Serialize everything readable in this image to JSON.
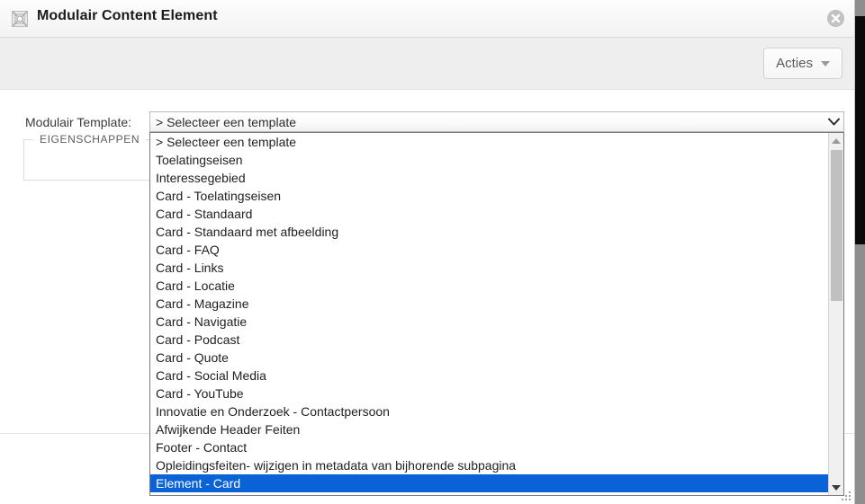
{
  "window": {
    "title": "Modulair Content Element",
    "icon": "content-element-icon",
    "close_icon": "close-circle-icon"
  },
  "toolbar": {
    "actions_label": "Acties",
    "actions_caret_icon": "caret-down-icon"
  },
  "form": {
    "template_label": "Modulair Template:",
    "fieldset_legend": "EIGENSCHAPPEN",
    "select": {
      "value": "> Selecteer een template",
      "arrow_icon": "chevron-down-icon",
      "expanded": true,
      "selected_option": "Element - Card",
      "options": [
        "> Selecteer een template",
        "Toelatingseisen",
        "Interessegebied",
        "Card - Toelatingseisen",
        "Card - Standaard",
        "Card - Standaard met afbeelding",
        "Card - FAQ",
        "Card - Links",
        "Card - Locatie",
        "Card - Magazine",
        "Card - Navigatie",
        "Card - Podcast",
        "Card - Quote",
        "Card - Social Media",
        "Card - YouTube",
        "Innovatie en Onderzoek - Contactpersoon",
        "Afwijkende Header Feiten",
        "Footer - Contact",
        "Opleidingsfeiten- wijzigen in metadata van bijhorende subpagina",
        "Element - Card"
      ]
    }
  },
  "scrollbars": {
    "dropdown": {
      "up_icon": "triangle-up-icon",
      "down_icon": "triangle-down-icon"
    },
    "page": {}
  },
  "resize": {
    "grip_icon": "resize-grip-icon"
  },
  "colors": {
    "selection_blue": "#0a63d6",
    "titlebar": "#f7f7f7",
    "toolbar": "#eeeeee"
  }
}
